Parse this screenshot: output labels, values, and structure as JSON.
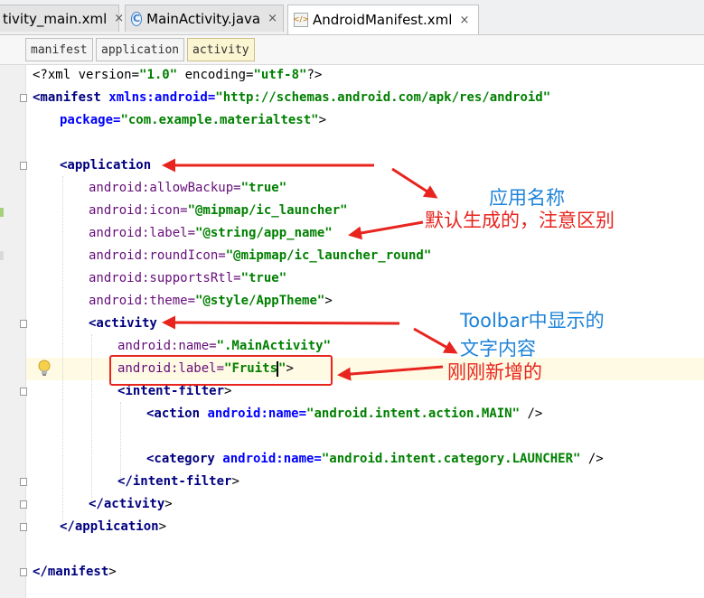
{
  "tabs": [
    {
      "label": "tivity_main.xml",
      "icon": "xml-file-icon",
      "active": false
    },
    {
      "label": "MainActivity.java",
      "icon": "java-class-icon",
      "active": false
    },
    {
      "label": "AndroidManifest.xml",
      "icon": "xml-file-icon",
      "active": true
    }
  ],
  "close_glyph": "×",
  "breadcrumbs": [
    "manifest",
    "application",
    "activity"
  ],
  "code": {
    "l1": {
      "a": "<?xml version=",
      "b": "\"1.0\"",
      "c": " encoding=",
      "d": "\"utf-8\"",
      "e": "?>"
    },
    "l2": {
      "a": "<manifest",
      "b": " xmlns:android=",
      "c": "\"http://schemas.android.com/apk/res/android\""
    },
    "l3": {
      "a": "package=",
      "b": "\"com.example.materialtest\"",
      "c": ">"
    },
    "l4": {
      "a": "<application"
    },
    "l5": {
      "a": "android:allowBackup=",
      "b": "\"true\""
    },
    "l6": {
      "a": "android:icon=",
      "b": "\"@mipmap/ic_launcher\""
    },
    "l7": {
      "a": "android:label=",
      "b": "\"@string/app_name\""
    },
    "l8": {
      "a": "android:roundIcon=",
      "b": "\"@mipmap/ic_launcher_round\""
    },
    "l9": {
      "a": "android:supportsRtl=",
      "b": "\"true\""
    },
    "l10": {
      "a": "android:theme=",
      "b": "\"@style/AppTheme\"",
      "c": ">"
    },
    "l11": {
      "a": "<activity"
    },
    "l12": {
      "a": "android:name=",
      "b": "\".MainActivity\""
    },
    "l13": {
      "a": "android:label=",
      "b": "\"Fruits",
      "c": "\"",
      "d": ">"
    },
    "l14": {
      "a": "<intent-filter",
      "b": ">"
    },
    "l15": {
      "a": "<action",
      "b": " android:name=",
      "c": "\"android.intent.action.MAIN\"",
      "d": " />"
    },
    "l16": {
      "a": "<category",
      "b": " android:name=",
      "c": "\"android.intent.category.LAUNCHER\"",
      "d": " />"
    },
    "l17": {
      "a": "</intent-filter",
      "b": ">"
    },
    "l18": {
      "a": "</activity",
      "b": ">"
    },
    "l19": {
      "a": "</application",
      "b": ">"
    },
    "l20": {
      "a": "</manifest",
      "b": ">"
    }
  },
  "annotations": {
    "app_name": "应用名称",
    "default_note": "默认生成的，注意区别",
    "toolbar_line1": "Toolbar中显示的",
    "toolbar_line2": "文字内容",
    "new_added": "刚刚新增的"
  },
  "colors": {
    "annotation_red": "#e8241e",
    "annotation_blue": "#1e83d8",
    "xml_tag": "#000080",
    "xml_attr": "#660e7a",
    "xml_value": "#008000"
  }
}
